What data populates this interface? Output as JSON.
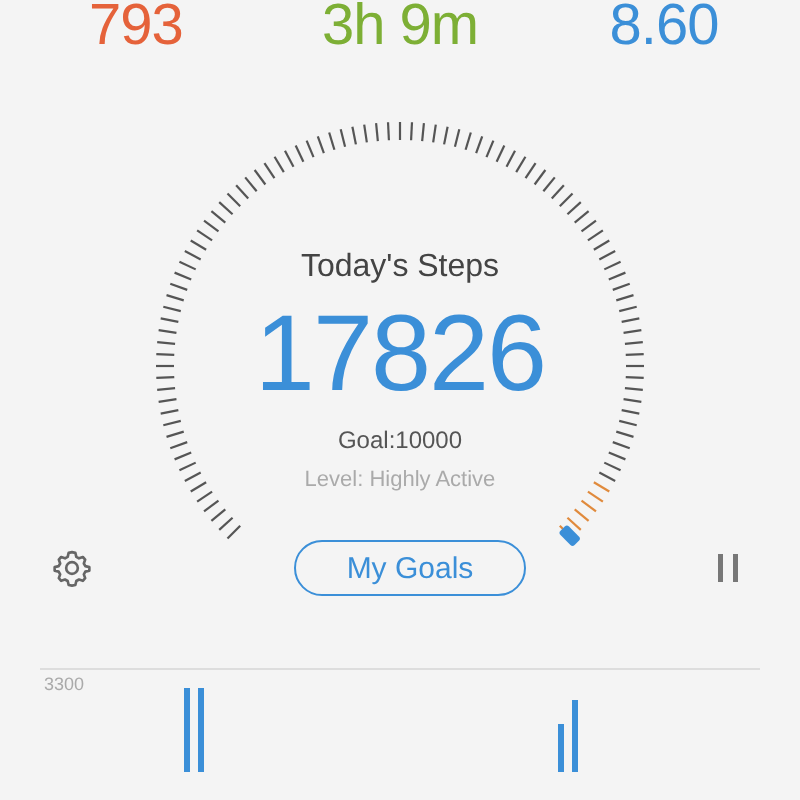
{
  "stats": [
    {
      "value": "793",
      "color": "#e5623a"
    },
    {
      "value": "3h 9m",
      "color": "#7daf35"
    },
    {
      "value": "8.60",
      "color": "#3b8fd8"
    }
  ],
  "gauge": {
    "title": "Today's Steps",
    "steps": "17826",
    "goal": "Goal:10000",
    "level_text": "Level: Highly Active"
  },
  "toolbar": {
    "button": "My Goals"
  },
  "chart": {
    "y_label": "3300"
  }
}
